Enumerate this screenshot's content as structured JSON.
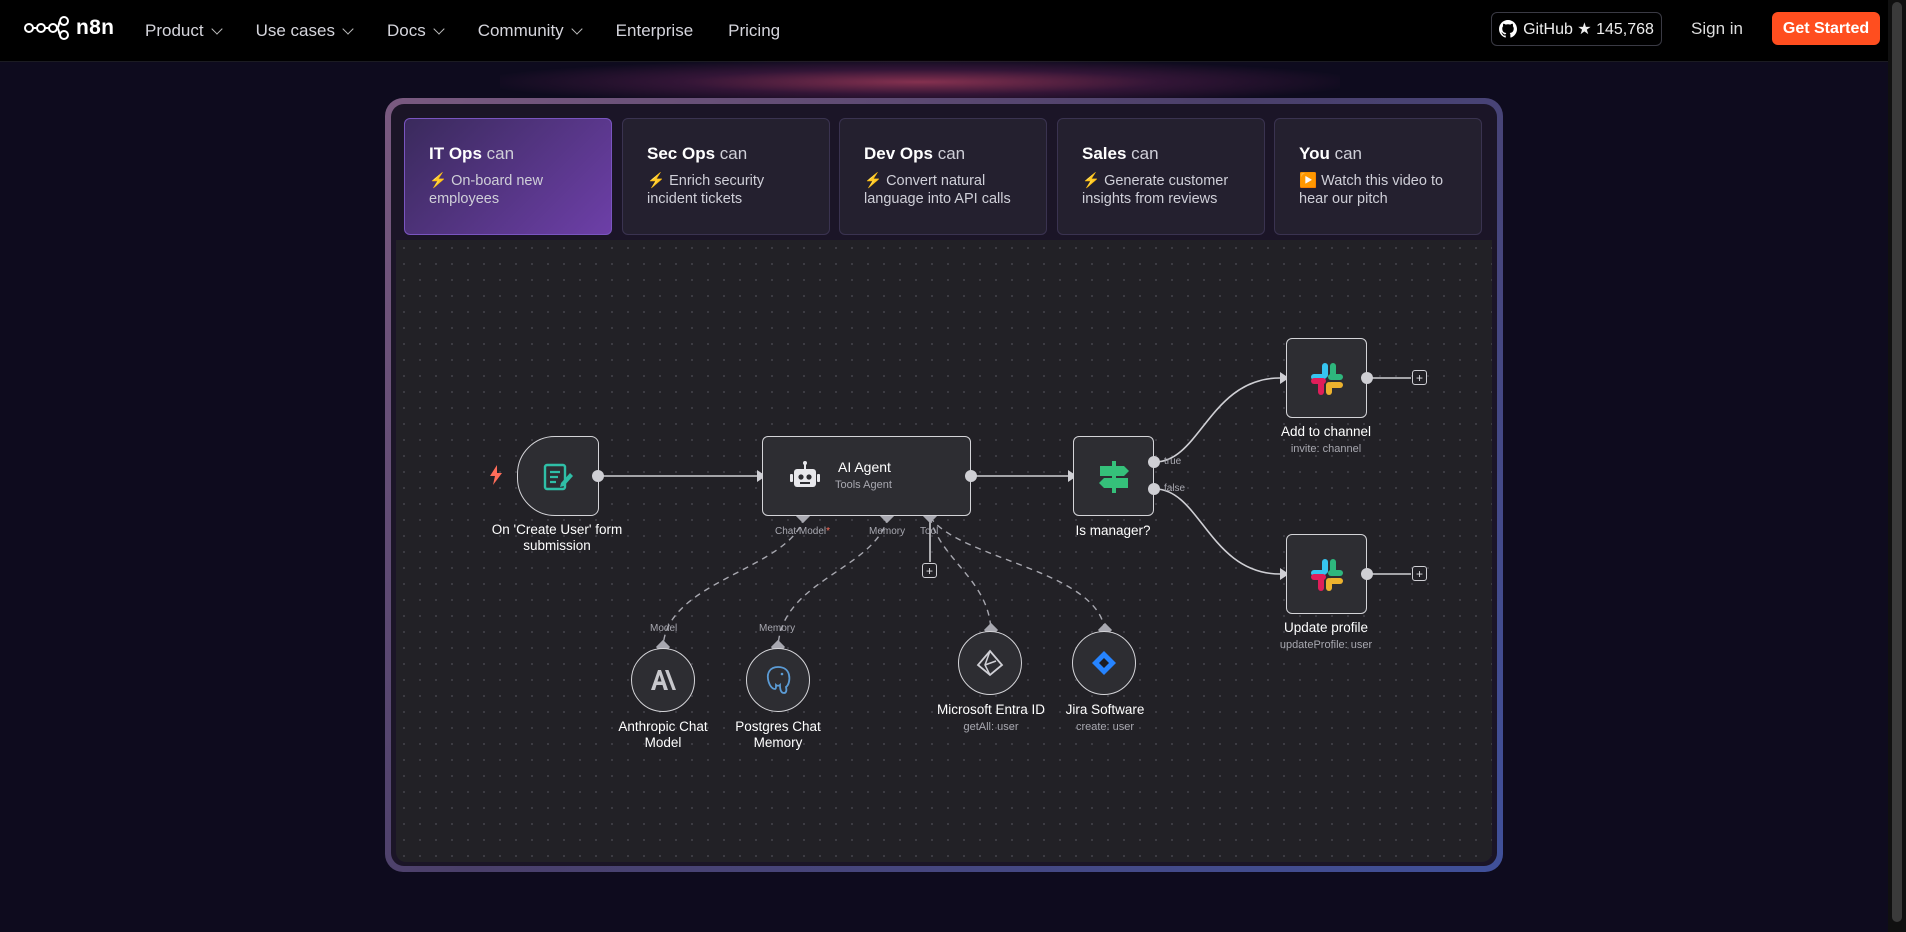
{
  "header": {
    "logo_text": "n8n",
    "nav": [
      "Product",
      "Use cases",
      "Docs",
      "Community",
      "Enterprise",
      "Pricing"
    ],
    "github_label": "GitHub ★ 145,768",
    "signin_label": "Sign in",
    "cta_label": "Get Started"
  },
  "tabs": [
    {
      "role": "IT Ops",
      "can": " can",
      "desc": "⚡ On-board new employees"
    },
    {
      "role": "Sec Ops",
      "can": " can",
      "desc": "⚡ Enrich security incident tickets"
    },
    {
      "role": "Dev Ops",
      "can": " can",
      "desc": "⚡ Convert natural language into API calls"
    },
    {
      "role": "Sales",
      "can": " can",
      "desc": "⚡ Generate customer insights from reviews"
    },
    {
      "role": "You",
      "can": " can",
      "desc": "▶️ Watch this video to hear our pitch"
    }
  ],
  "workflow": {
    "trigger": {
      "label": "On 'Create User' form submission"
    },
    "agent": {
      "title": "AI Agent",
      "subtitle": "Tools Agent",
      "port_chat_model": "Chat Model",
      "port_memory": "Memory",
      "port_tool": "Tool"
    },
    "if_node": {
      "label": "Is manager?",
      "true_label": "true",
      "false_label": "false"
    },
    "slack_add": {
      "label": "Add to channel",
      "sub": "invite: channel"
    },
    "slack_update": {
      "label": "Update profile",
      "sub": "updateProfile: user"
    },
    "anthropic": {
      "label": "Anthropic Chat Model",
      "port": "Model"
    },
    "postgres": {
      "label": "Postgres Chat Memory",
      "port": "Memory"
    },
    "entra": {
      "label": "Microsoft Entra ID",
      "sub": "getAll: user"
    },
    "jira": {
      "label": "Jira Software",
      "sub": "create: user"
    }
  },
  "colors": {
    "accent": "#ff4e1f",
    "active_tab": "#6d3fa8",
    "canvas": "#222126"
  }
}
